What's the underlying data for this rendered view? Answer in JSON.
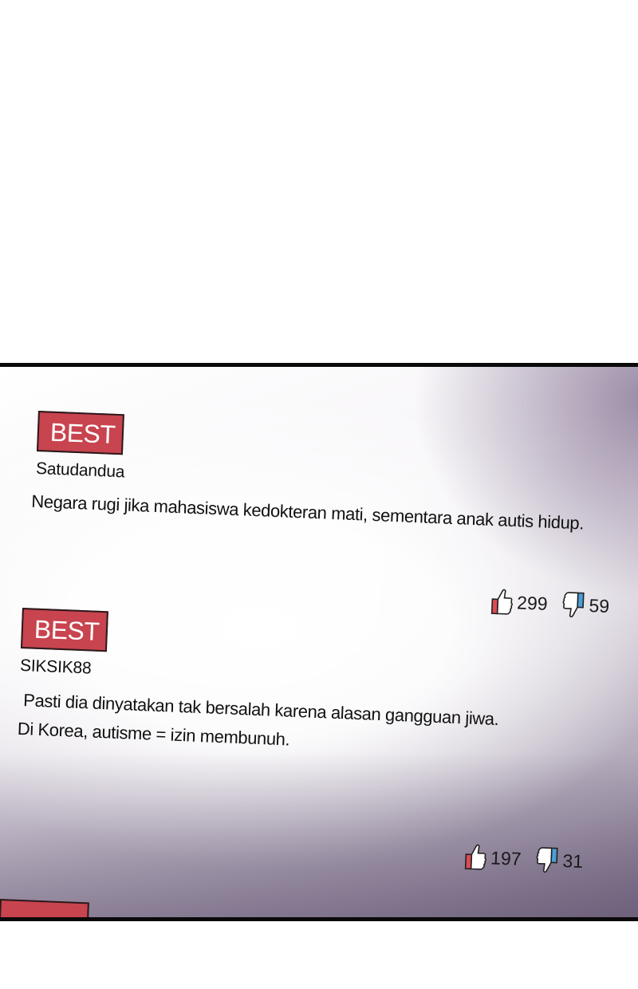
{
  "comments": [
    {
      "badge": "BEST",
      "user": "Satudandua",
      "lines": [
        "Negara rugi jika mahasiswa kedokteran mati, sementara anak autis hidup."
      ],
      "likes": "299",
      "dislikes": "59"
    },
    {
      "badge": "BEST",
      "user": "SIKSIK88",
      "lines": [
        "Pasti dia dinyatakan tak bersalah karena alasan gangguan jiwa.",
        "Di Korea, autisme = izin membunuh."
      ],
      "likes": "197",
      "dislikes": "31"
    }
  ],
  "icons": {
    "like": "thumbs-up-icon",
    "dislike": "thumbs-down-icon"
  },
  "colors": {
    "badge": "#c8444f",
    "like_accent": "#d94b55",
    "dislike_accent": "#4a9fd8"
  }
}
